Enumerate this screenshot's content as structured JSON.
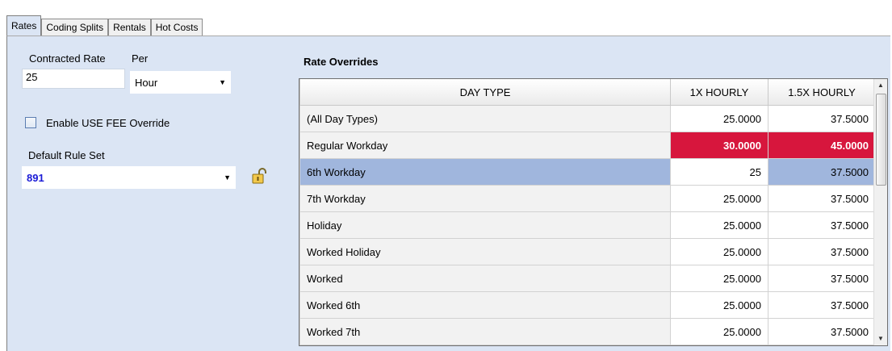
{
  "tabs": [
    "Rates",
    "Coding Splits",
    "Rentals",
    "Hot Costs"
  ],
  "left": {
    "contracted_rate_label": "Contracted Rate",
    "per_label": "Per",
    "contracted_rate_value": "25",
    "per_value": "Hour",
    "fee_override_label": "Enable USE FEE Override",
    "default_rule_set_label": "Default Rule Set",
    "default_rule_set_value": "891"
  },
  "overrides": {
    "title": "Rate Overrides",
    "columns": [
      "DAY TYPE",
      "1X HOURLY",
      "1.5X HOURLY"
    ],
    "rows": [
      {
        "day": "(All Day Types)",
        "x1": "25.0000",
        "x15": "37.5000"
      },
      {
        "day": "Regular Workday",
        "x1": "30.0000",
        "x15": "45.0000"
      },
      {
        "day": "6th Workday",
        "x1": "25",
        "x15": "37.5000"
      },
      {
        "day": "7th Workday",
        "x1": "25.0000",
        "x15": "37.5000"
      },
      {
        "day": "Holiday",
        "x1": "25.0000",
        "x15": "37.5000"
      },
      {
        "day": "Worked Holiday",
        "x1": "25.0000",
        "x15": "37.5000"
      },
      {
        "day": "Worked",
        "x1": "25.0000",
        "x15": "37.5000"
      },
      {
        "day": "Worked 6th",
        "x1": "25.0000",
        "x15": "37.5000"
      },
      {
        "day": "Worked 7th",
        "x1": "25.0000",
        "x15": "37.5000"
      }
    ]
  },
  "colors": {
    "panel_bg": "#dbe5f4",
    "override_red": "#d7163d",
    "selected_row": "#a0b6dd",
    "rule_set_text": "#1a1ad6"
  },
  "icons": {
    "lock": "lock-icon",
    "dropdown": "chevron-down-icon"
  }
}
